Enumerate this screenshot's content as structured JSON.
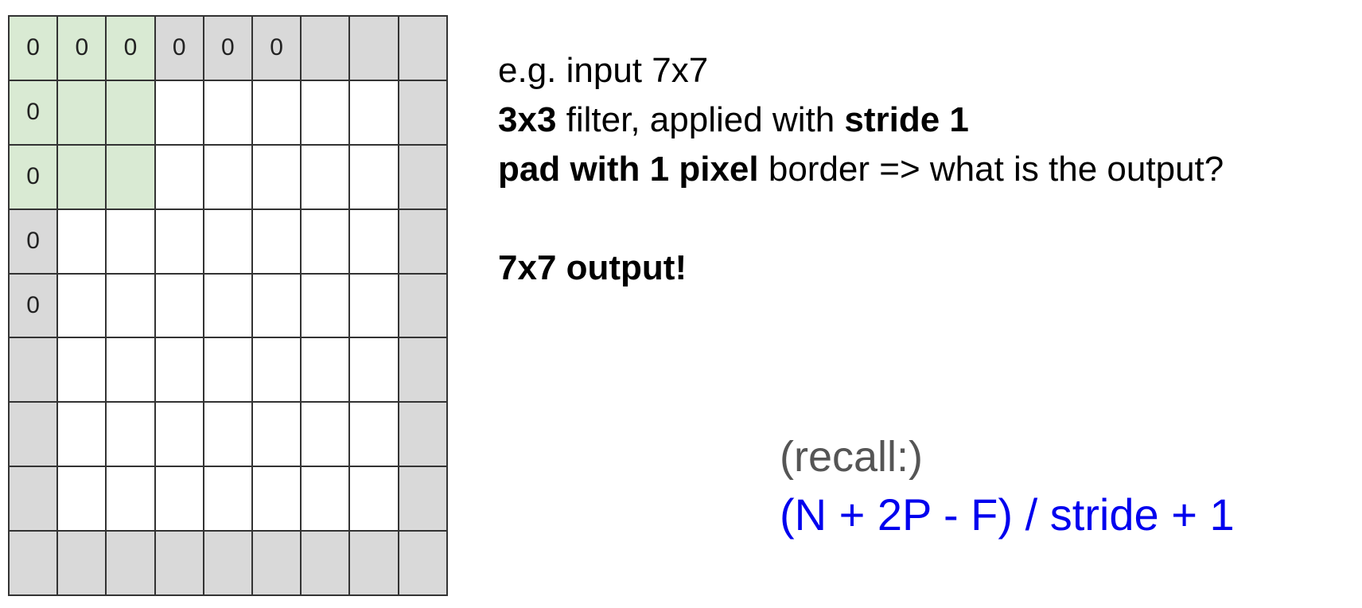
{
  "grid": {
    "rows": 9,
    "cols": 9,
    "colors": {
      "padding": "#d9d9d9",
      "filter": "#d9ead3",
      "input": "#ffffff",
      "border": "#333333"
    },
    "padding_cells": "outer ring of the 9x9 grid (1 pixel border around 7x7 input)",
    "filter_window": {
      "row_start": 0,
      "col_start": 0,
      "size": 3
    },
    "zero_labels": [
      {
        "row": 0,
        "col": 0,
        "text": "0"
      },
      {
        "row": 0,
        "col": 1,
        "text": "0"
      },
      {
        "row": 0,
        "col": 2,
        "text": "0"
      },
      {
        "row": 0,
        "col": 3,
        "text": "0"
      },
      {
        "row": 0,
        "col": 4,
        "text": "0"
      },
      {
        "row": 0,
        "col": 5,
        "text": "0"
      },
      {
        "row": 1,
        "col": 0,
        "text": "0"
      },
      {
        "row": 2,
        "col": 0,
        "text": "0"
      },
      {
        "row": 3,
        "col": 0,
        "text": "0"
      },
      {
        "row": 4,
        "col": 0,
        "text": "0"
      }
    ]
  },
  "text": {
    "line1": "e.g. input 7x7",
    "line2_bold": "3x3",
    "line2_mid": " filter, applied with ",
    "line2_bold2": "stride 1",
    "line3_bold": "pad with 1 pixel",
    "line3_rest": " border => what is the output?",
    "line4_bold": "7x7 output!"
  },
  "recall": {
    "label": "(recall:)",
    "formula": "(N + 2P - F) / stride + 1",
    "formula_color": "#0000ee",
    "label_color": "#555555"
  }
}
